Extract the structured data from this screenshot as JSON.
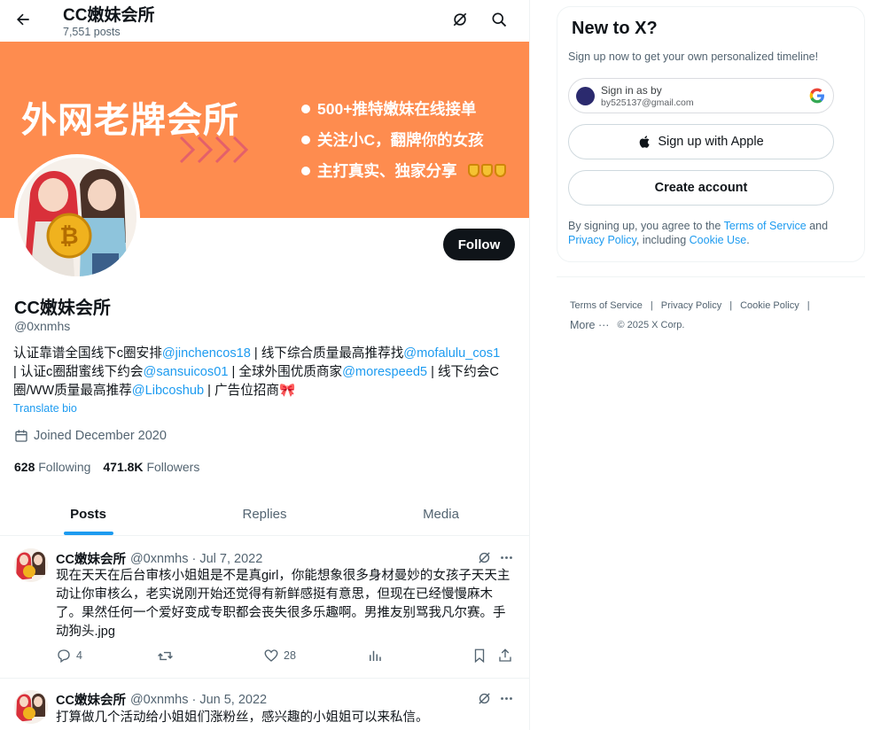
{
  "header": {
    "title": "CC嫩妹会所",
    "post_count": "7,551 posts"
  },
  "banner": {
    "title": "外网老牌会所",
    "lines": [
      "500+推特嫩妹在线接单",
      "关注小C，翻牌你的女孩",
      "主打真实、独家分享"
    ],
    "color": "#fe8c4f"
  },
  "profile": {
    "name": "CC嫩妹会所",
    "handle": "@0xnmhs",
    "follow_label": "Follow",
    "bio": {
      "t1": "认证靠谱全国线下c圈安排",
      "m1": "@jinchencos18",
      "t2": " | 线下综合质量最高推荐找",
      "m2": "@mofalulu_cos1",
      "t3": " | 认证c圈甜蜜线下约会",
      "m3": "@sansuicos01",
      "t4": " | 全球外围优质商家",
      "m4": "@morespeed5",
      "t5": " | 线下约会C圈/WW质量最高推荐",
      "m5": "@Libcoshub",
      "t6": " | 广告位招商🎀"
    },
    "translate_label": "Translate bio",
    "joined": "Joined December 2020",
    "following_count": "628",
    "following_label": "Following",
    "followers_count": "471.8K",
    "followers_label": "Followers"
  },
  "tabs": [
    "Posts",
    "Replies",
    "Media"
  ],
  "active_tab": "Posts",
  "posts": [
    {
      "name": "CC嫩妹会所",
      "meta": "@0xnmhs · Jul 7, 2022",
      "text": "现在天天在后台审核小姐姐是不是真girl，你能想象很多身材曼妙的女孩子天天主动让你审核么，老实说刚开始还觉得有新鲜感挺有意思，但现在已经慢慢麻木了。果然任何一个爱好变成专职都会丧失很多乐趣啊。男推友别骂我凡尔赛。手动狗头.jpg",
      "replies": "4",
      "likes": "28"
    },
    {
      "name": "CC嫩妹会所",
      "meta": "@0xnmhs · Jun 5, 2022",
      "text": "打算做几个活动给小姐姐们涨粉丝，感兴趣的小姐姐可以来私信。"
    }
  ],
  "signup": {
    "title": "New to X?",
    "subtitle": "Sign up now to get your own personalized timeline!",
    "google_line1": "Sign in as by",
    "google_line2": "by525137@gmail.com",
    "apple_label": "Sign up with Apple",
    "create_label": "Create account",
    "terms_t1": "By signing up, you agree to the ",
    "terms_l1": "Terms of Service",
    "terms_t2": " and ",
    "terms_l2": "Privacy Policy",
    "terms_t3": ", including ",
    "terms_l3": "Cookie Use",
    "terms_t4": "."
  },
  "footer": {
    "links": [
      "Terms of Service",
      "Privacy Policy",
      "Cookie Policy"
    ],
    "more": "More",
    "copyright": "© 2025 X Corp."
  },
  "colors": {
    "accent": "#1d9bf0",
    "text": "#0f1419",
    "muted": "#536471"
  }
}
